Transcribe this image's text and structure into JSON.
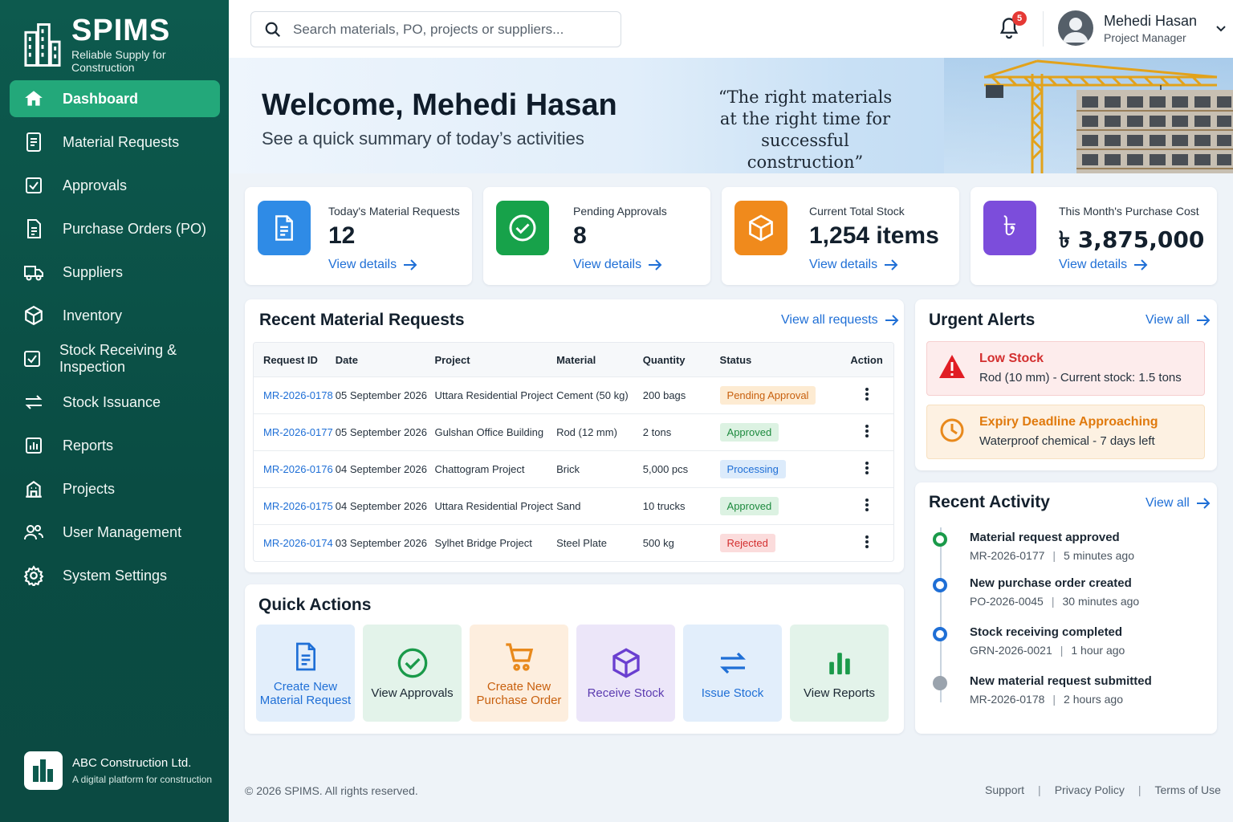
{
  "brand": {
    "name": "SPIMS",
    "tagline": "Reliable Supply for Construction"
  },
  "sidebar": {
    "items": [
      {
        "label": "Dashboard",
        "icon": "home-icon",
        "active": true
      },
      {
        "label": "Material Requests",
        "icon": "document-icon"
      },
      {
        "label": "Approvals",
        "icon": "check-square-icon"
      },
      {
        "label": "Purchase Orders (PO)",
        "icon": "purchase-doc-icon"
      },
      {
        "label": "Suppliers",
        "icon": "truck-icon"
      },
      {
        "label": "Inventory",
        "icon": "box-icon"
      },
      {
        "label": "Stock Receiving & Inspection",
        "icon": "check-square-icon"
      },
      {
        "label": "Stock Issuance",
        "icon": "transfer-icon"
      },
      {
        "label": "Reports",
        "icon": "bar-chart-icon"
      },
      {
        "label": "Projects",
        "icon": "building-icon"
      },
      {
        "label": "User Management",
        "icon": "users-icon"
      },
      {
        "label": "System Settings",
        "icon": "gear-icon"
      }
    ],
    "org_name": "ABC Construction Ltd.",
    "org_tagline": "A digital platform for construction"
  },
  "topbar": {
    "search_placeholder": "Search materials, PO, projects or suppliers...",
    "notification_count": "5",
    "user_name": "Mehedi Hasan",
    "user_role": "Project Manager"
  },
  "hero": {
    "title": "Welcome, Mehedi Hasan",
    "subtitle": "See a quick summary of today’s activities",
    "quote_line1": "“The right materials",
    "quote_line2": "at the right time for",
    "quote_line3": "successful construction”"
  },
  "stats": [
    {
      "label": "Today's Material Requests",
      "value": "12",
      "link": "View details",
      "color": "#2f8be6"
    },
    {
      "label": "Pending Approvals",
      "value": "8",
      "link": "View details",
      "color": "#17a24a"
    },
    {
      "label": "Current Total Stock",
      "value": "1,254 items",
      "link": "View details",
      "color": "#f08a1c"
    },
    {
      "label": "This Month's Purchase Cost",
      "value": "৳ 3,875,000",
      "link": "View details",
      "color": "#7c4ddb"
    }
  ],
  "requests": {
    "title": "Recent Material Requests",
    "view_all": "View all requests",
    "columns": [
      "Request ID",
      "Date",
      "Project",
      "Material",
      "Quantity",
      "Status",
      "Action"
    ],
    "rows": [
      {
        "id": "MR-2026-0178",
        "date": "05 September 2026",
        "project": "Uttara Residential Project",
        "material": "Cement (50 kg)",
        "quantity": "200 bags",
        "status": "Pending Approval"
      },
      {
        "id": "MR-2026-0177",
        "date": "05 September 2026",
        "project": "Gulshan Office Building",
        "material": "Rod (12 mm)",
        "quantity": "2 tons",
        "status": "Approved"
      },
      {
        "id": "MR-2026-0176",
        "date": "04 September 2026",
        "project": "Chattogram Project",
        "material": "Brick",
        "quantity": "5,000 pcs",
        "status": "Processing"
      },
      {
        "id": "MR-2026-0175",
        "date": "04 September 2026",
        "project": "Uttara Residential Project",
        "material": "Sand",
        "quantity": "10 trucks",
        "status": "Approved"
      },
      {
        "id": "MR-2026-0174",
        "date": "03 September 2026",
        "project": "Sylhet Bridge Project",
        "material": "Steel Plate",
        "quantity": "500 kg",
        "status": "Rejected"
      }
    ]
  },
  "status_colors": {
    "Pending Approval": {
      "bg": "#fdebd2",
      "fg": "#c8600e"
    },
    "Approved": {
      "bg": "#dcf2e2",
      "fg": "#1d8a3e"
    },
    "Processing": {
      "bg": "#dcebfb",
      "fg": "#1f6fd6"
    },
    "Rejected": {
      "bg": "#fbdcdc",
      "fg": "#d32f2f"
    }
  },
  "quick_actions": {
    "title": "Quick Actions",
    "items": [
      {
        "line1": "Create New",
        "line2": "Material Request",
        "icon": "document-icon",
        "bg": "#e2eefb",
        "fg": "#1f6fd6"
      },
      {
        "line1": "View Approvals",
        "line2": "",
        "icon": "check-circle-icon",
        "bg": "#e3f3ea",
        "fg": "#1b2733"
      },
      {
        "line1": "Create New",
        "line2": "Purchase Order",
        "icon": "cart-icon",
        "bg": "#fdeede",
        "fg": "#c8600e"
      },
      {
        "line1": "Receive Stock",
        "line2": "",
        "icon": "box-icon",
        "bg": "#ece6f9",
        "fg": "#5b3bb0"
      },
      {
        "line1": "Issue Stock",
        "line2": "",
        "icon": "transfer-icon",
        "bg": "#e2eefb",
        "fg": "#1f6fd6"
      },
      {
        "line1": "View Reports",
        "line2": "",
        "icon": "bar-chart-icon",
        "bg": "#e3f3ea",
        "fg": "#1b2733"
      }
    ]
  },
  "alerts": {
    "title": "Urgent Alerts",
    "view_all": "View all",
    "items": [
      {
        "title": "Low Stock",
        "text": "Rod (10 mm) - Current stock: 1.5 tons",
        "icon": "warning-icon"
      },
      {
        "title": "Expiry Deadline Approaching",
        "text": "Waterproof chemical - 7 days left",
        "icon": "clock-icon"
      }
    ]
  },
  "activity": {
    "title": "Recent Activity",
    "view_all": "View all",
    "items": [
      {
        "title": "Material request approved",
        "ref": "MR-2026-0177",
        "time": "5 minutes ago"
      },
      {
        "title": "New purchase order created",
        "ref": "PO-2026-0045",
        "time": "30 minutes ago"
      },
      {
        "title": "Stock receiving completed",
        "ref": "GRN-2026-0021",
        "time": "1 hour ago"
      },
      {
        "title": "New material request submitted",
        "ref": "MR-2026-0178",
        "time": "2 hours ago"
      }
    ]
  },
  "footer": {
    "copyright": "© 2026 SPIMS. All rights reserved.",
    "links": [
      "Support",
      "Privacy Policy",
      "Terms of Use"
    ]
  }
}
